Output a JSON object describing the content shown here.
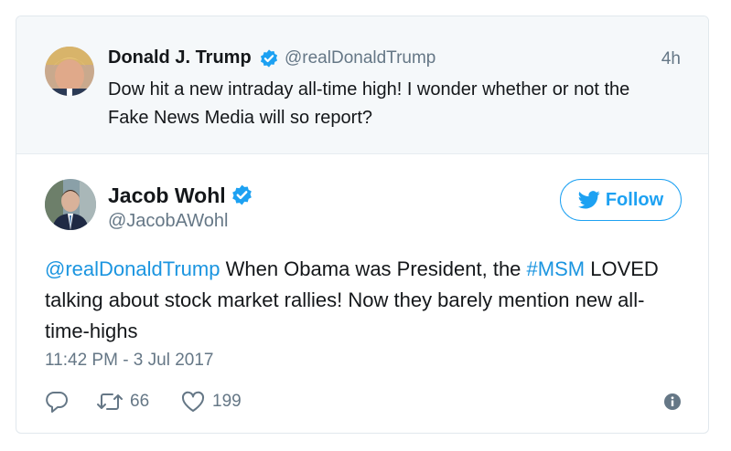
{
  "parent_tweet": {
    "name": "Donald J. Trump",
    "handle": "@realDonaldTrump",
    "time": "4h",
    "text": "Dow hit a new intraday all-time high! I wonder whether or not the Fake News Media will so report?"
  },
  "main_tweet": {
    "name": "Jacob Wohl",
    "handle": "@JacobAWohl",
    "follow_label": "Follow",
    "text_mention": "@realDonaldTrump",
    "text_part1": " When Obama was President, the ",
    "text_hashtag": "#MSM",
    "text_part2": " LOVED talking about stock market rallies! Now they barely mention new all-time-highs",
    "timestamp": "11:42 PM - 3 Jul 2017",
    "retweets": "66",
    "likes": "199"
  },
  "icons": {
    "verified": "verified-badge-icon",
    "follow": "twitter-bird-icon",
    "reply": "reply-icon",
    "retweet": "retweet-icon",
    "like": "heart-icon",
    "info": "info-icon"
  },
  "colors": {
    "accent": "#1da1f2",
    "link": "#1b95e0",
    "muted": "#657786",
    "parent_bg": "#f5f8fa",
    "verified": "#1da1f2"
  }
}
